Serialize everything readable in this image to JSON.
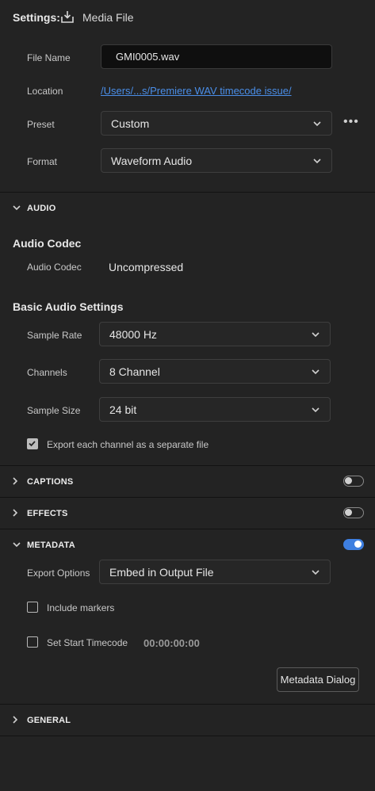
{
  "header": {
    "title": "Settings:",
    "subtitle": "Media File",
    "icon": "export-icon"
  },
  "file": {
    "name_label": "File Name",
    "name_value": "GMI0005.wav",
    "location_label": "Location",
    "location_value": "/Users/...s/Premiere WAV timecode issue/",
    "preset_label": "Preset",
    "preset_value": "Custom",
    "more": "•••",
    "format_label": "Format",
    "format_value": "Waveform Audio"
  },
  "audio": {
    "section": "AUDIO",
    "codec_heading": "Audio Codec",
    "codec_label": "Audio Codec",
    "codec_value": "Uncompressed",
    "basic_heading": "Basic Audio Settings",
    "rate_label": "Sample Rate",
    "rate_value": "48000 Hz",
    "channels_label": "Channels",
    "channels_value": "8 Channel",
    "size_label": "Sample Size",
    "size_value": "24 bit",
    "export_each_label": "Export each channel as a separate file",
    "export_each_checked": true
  },
  "captions": {
    "section": "CAPTIONS",
    "enabled": false
  },
  "effects": {
    "section": "EFFECTS",
    "enabled": false
  },
  "metadata": {
    "section": "METADATA",
    "enabled": true,
    "export_label": "Export Options",
    "export_value": "Embed in Output File",
    "markers_label": "Include markers",
    "markers_checked": false,
    "timecode_label": "Set Start Timecode",
    "timecode_checked": false,
    "timecode_value": "00:00:00:00",
    "dialog_button": "Metadata Dialog"
  },
  "general": {
    "section": "GENERAL"
  },
  "colors": {
    "accent": "#3e7fe0",
    "link": "#4a8ee8",
    "background": "#232323"
  }
}
